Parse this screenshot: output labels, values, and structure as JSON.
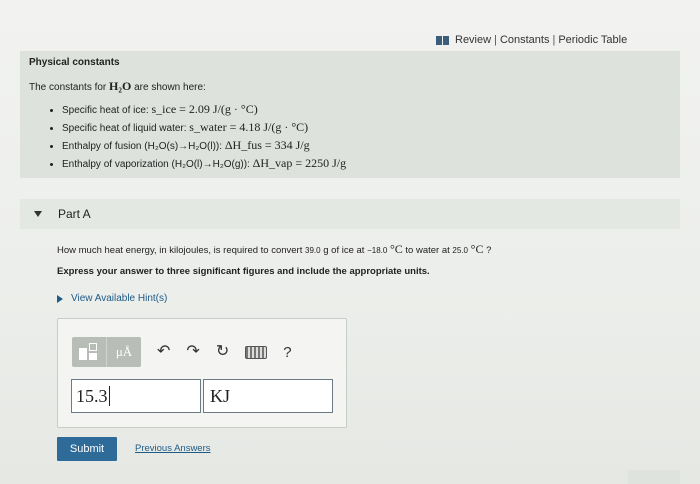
{
  "toplinks": {
    "review": "Review",
    "sep1": "|",
    "constants": "Constants",
    "sep2": "|",
    "periodic": "Periodic Table"
  },
  "constants_panel": {
    "title": "Physical constants",
    "intro_prefix": "The constants for",
    "intro_chem": "H₂O",
    "intro_suffix": "are shown here:",
    "items": [
      {
        "label": "Specific heat of ice:",
        "formula": "s_ice = 2.09 J/(g · °C)"
      },
      {
        "label": "Specific heat of liquid water:",
        "formula": "s_water = 4.18 J/(g · °C)"
      },
      {
        "label": "Enthalpy of fusion (H₂O(s)→H₂O(l)):",
        "formula": "ΔH_fus = 334 J/g"
      },
      {
        "label": "Enthalpy of vaporization (H₂O(l)→H₂O(g)):",
        "formula": "ΔH_vap = 2250 J/g"
      }
    ]
  },
  "part": {
    "label": "Part A"
  },
  "question": {
    "q1": "How much heat energy, in kilojoules, is required to convert",
    "mass": "39.0",
    "q2": "g of ice at",
    "t1": "−18.0",
    "unit1": "°C",
    "q3": "to water at",
    "t2": "25.0",
    "unit2": "°C",
    "q4": "?",
    "instruction": "Express your answer to three significant figures and include the appropriate units.",
    "hints": "View Available Hint(s)"
  },
  "toolbar": {
    "template_icon": "template-icon",
    "mu_label": "μÅ",
    "undo": "↶",
    "redo": "↷",
    "reset": "↻",
    "keyboard_icon": "keyboard-icon",
    "help": "?"
  },
  "answer": {
    "value": "15.3",
    "unit": "KJ"
  },
  "actions": {
    "submit": "Submit",
    "previous": "Previous Answers"
  }
}
